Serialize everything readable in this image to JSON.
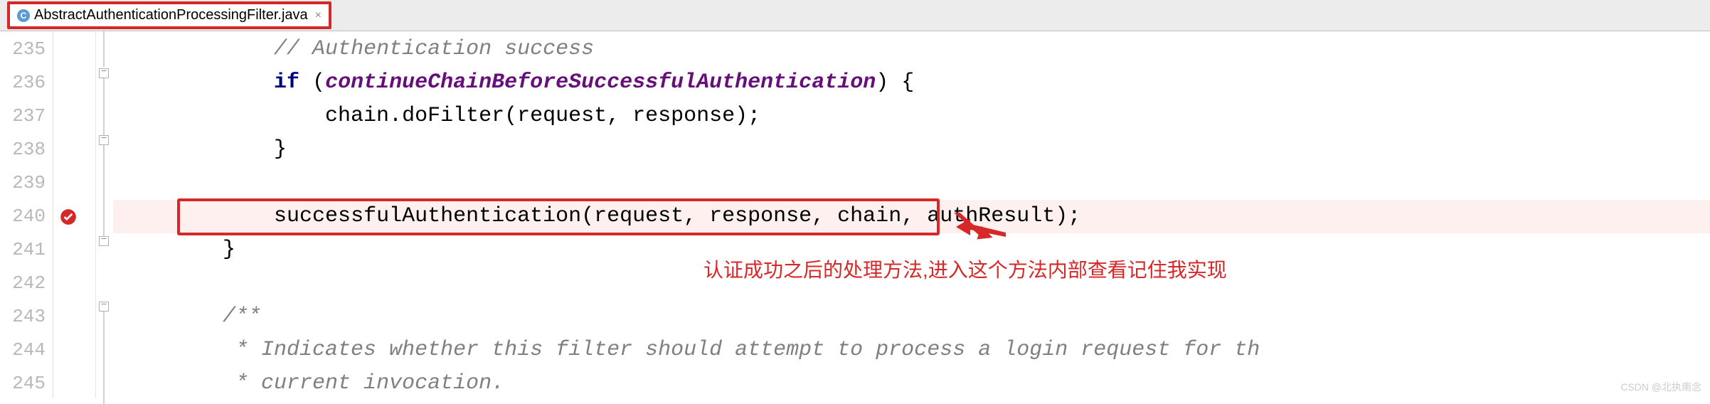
{
  "tab": {
    "filename": "AbstractAuthenticationProcessingFilter.java"
  },
  "lines": {
    "235": {
      "num": "235",
      "indent": "            ",
      "comment": "// Authentication success"
    },
    "236": {
      "num": "236",
      "indent": "            ",
      "kw": "if",
      "paren_open": " (",
      "ident": "continueChainBeforeSuccessfulAuthentication",
      "paren_close": ") {"
    },
    "237": {
      "num": "237",
      "indent": "                ",
      "text": "chain.doFilter(request, response);"
    },
    "238": {
      "num": "238",
      "indent": "            ",
      "text": "}"
    },
    "239": {
      "num": "239"
    },
    "240": {
      "num": "240",
      "indent": "            ",
      "text": "successfulAuthentication(request, response, chain, authResult);"
    },
    "241": {
      "num": "241",
      "indent": "        ",
      "text": "}"
    },
    "242": {
      "num": "242"
    },
    "243": {
      "num": "243",
      "indent": "        ",
      "comment": "/**"
    },
    "244": {
      "num": "244",
      "indent": "         ",
      "comment": "* Indicates whether this filter should attempt to process a login request for th"
    },
    "245": {
      "num": "245",
      "indent": "         ",
      "comment": "* current invocation."
    }
  },
  "annotation": "认证成功之后的处理方法,进入这个方法内部查看记住我实现",
  "watermark": "CSDN @北执南念"
}
